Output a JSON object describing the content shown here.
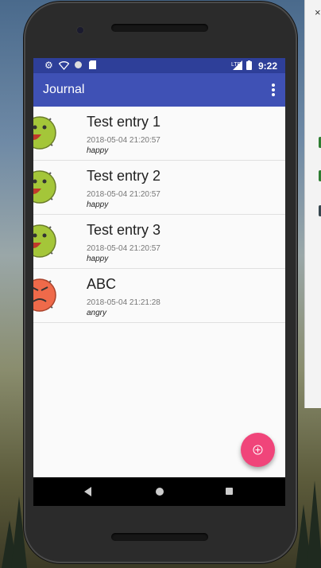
{
  "status_bar": {
    "time": "9:22",
    "network": "LTE",
    "left_icons": [
      "gear-icon",
      "wifi-question-icon",
      "circle-icon",
      "sd-card-icon"
    ],
    "right_icons": [
      "signal-icon",
      "battery-icon"
    ]
  },
  "app_bar": {
    "title": "Journal",
    "menu_icon": "more-vert-icon"
  },
  "entries": [
    {
      "title": "Test entry 1",
      "date": "2018-05-04 21:20:57",
      "mood": "happy",
      "avatar_color": "#a4c639"
    },
    {
      "title": "Test entry 2",
      "date": "2018-05-04 21:20:57",
      "mood": "happy",
      "avatar_color": "#a4c639"
    },
    {
      "title": "Test entry 3",
      "date": "2018-05-04 21:20:57",
      "mood": "happy",
      "avatar_color": "#a4c639"
    },
    {
      "title": "ABC",
      "date": "2018-05-04 21:21:28",
      "mood": "angry",
      "avatar_color": "#ef6a4a"
    }
  ],
  "fab": {
    "icon": "add-circle-icon",
    "color": "#f0457a"
  },
  "nav_bar": {
    "icons": [
      "back-icon",
      "home-icon",
      "recents-icon"
    ]
  },
  "colors": {
    "primary": "#3f51b5",
    "primary_dark": "#2e3f99",
    "accent": "#f0457a"
  },
  "side_panel": {
    "close_glyph": "×"
  }
}
